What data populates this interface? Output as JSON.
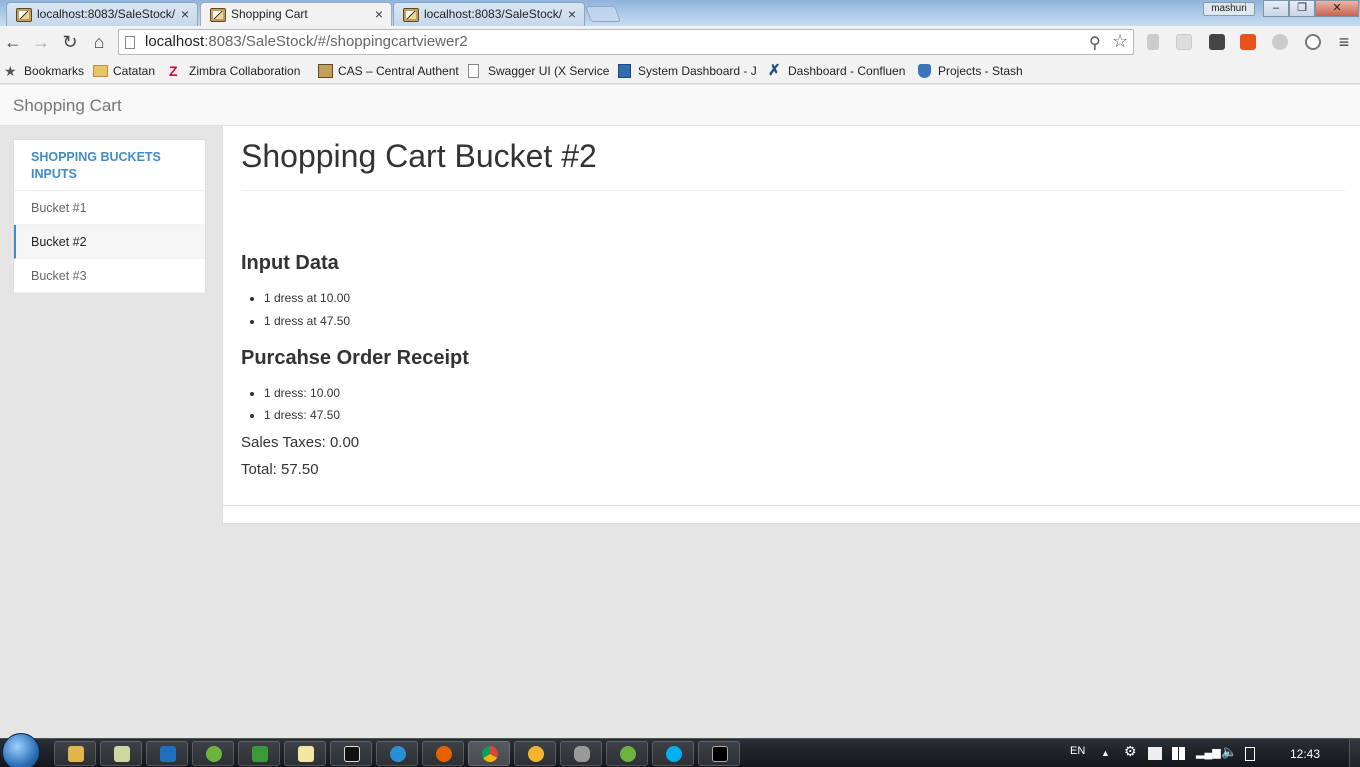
{
  "browser": {
    "tabs": [
      {
        "title": "localhost:8083/SaleStock/",
        "active": false
      },
      {
        "title": "Shopping Cart",
        "active": true
      },
      {
        "title": "localhost:8083/SaleStock/",
        "active": false
      }
    ],
    "tab_close_glyph": "×",
    "user_badge": "mashuri",
    "window_controls": {
      "minimize": "–",
      "restore": "❐",
      "close": "✕"
    },
    "url_host": "localhost",
    "url_rest": ":8083/SaleStock/#/shoppingcartviewer2"
  },
  "bookmarks": [
    {
      "label": "Bookmarks",
      "icon": "star-icon"
    },
    {
      "label": "Catatan",
      "icon": "folder-icon"
    },
    {
      "label": "Zimbra Collaboration",
      "icon": "zimbra-icon"
    },
    {
      "label": "CAS – Central Authent",
      "icon": "cas-icon"
    },
    {
      "label": "Swagger UI (X Service",
      "icon": "page-icon"
    },
    {
      "label": "System Dashboard - J",
      "icon": "jira-icon"
    },
    {
      "label": "Dashboard - Confluen",
      "icon": "confluence-icon"
    },
    {
      "label": "Projects - Stash",
      "icon": "stash-icon"
    }
  ],
  "app": {
    "brand": "Shopping Cart",
    "sidebar": {
      "header": "SHOPPING BUCKETS INPUTS",
      "items": [
        {
          "label": "Bucket #1",
          "active": false
        },
        {
          "label": "Bucket #2",
          "active": true
        },
        {
          "label": "Bucket #3",
          "active": false
        }
      ]
    },
    "main": {
      "title": "Shopping Cart Bucket #2",
      "input_heading": "Input Data",
      "input_items": [
        "1 dress at 10.00",
        "1 dress at 47.50"
      ],
      "receipt_heading": "Purcahse Order Receipt",
      "receipt_items": [
        "1  dress: 10.00",
        "1  dress: 47.50"
      ],
      "sales_taxes": "Sales Taxes: 0.00",
      "total": "Total: 57.50"
    }
  },
  "taskbar": {
    "language": "EN",
    "clock": "12:43"
  }
}
